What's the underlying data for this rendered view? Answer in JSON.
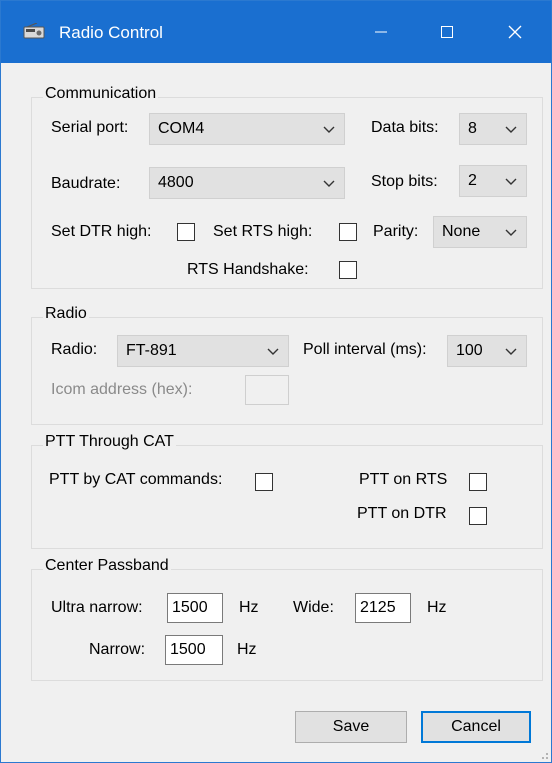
{
  "window": {
    "title": "Radio Control",
    "icons": {
      "app": "radio-icon",
      "minimize": "minimize-icon",
      "maximize": "maximize-icon",
      "close": "close-icon"
    }
  },
  "communication": {
    "group_label": "Communication",
    "serial_port_label": "Serial port:",
    "serial_port_value": "COM4",
    "data_bits_label": "Data bits:",
    "data_bits_value": "8",
    "baudrate_label": "Baudrate:",
    "baudrate_value": "4800",
    "stop_bits_label": "Stop bits:",
    "stop_bits_value": "2",
    "dtr_label": "Set DTR high:",
    "rts_label": "Set RTS high:",
    "parity_label": "Parity:",
    "parity_value": "None",
    "rts_handshake_label": "RTS Handshake:"
  },
  "radio": {
    "group_label": "Radio",
    "radio_label": "Radio:",
    "radio_value": "FT-891",
    "poll_label": "Poll interval (ms):",
    "poll_value": "100",
    "icom_label": "Icom address (hex):",
    "icom_value": ""
  },
  "ptt": {
    "group_label": "PTT Through CAT",
    "cat_label": "PTT by CAT commands:",
    "rts_label": "PTT on RTS",
    "dtr_label": "PTT on DTR"
  },
  "passband": {
    "group_label": "Center Passband",
    "ultra_narrow_label": "Ultra narrow:",
    "ultra_narrow_value": "1500",
    "ultra_narrow_unit": "Hz",
    "wide_label": "Wide:",
    "wide_value": "2125",
    "wide_unit": "Hz",
    "narrow_label": "Narrow:",
    "narrow_value": "1500",
    "narrow_unit": "Hz"
  },
  "buttons": {
    "save_label": "Save",
    "cancel_label": "Cancel"
  },
  "colors": {
    "titlebar": "#1a6fd0",
    "window_bg": "#f0f0f0",
    "focus_border": "#0078d7"
  }
}
